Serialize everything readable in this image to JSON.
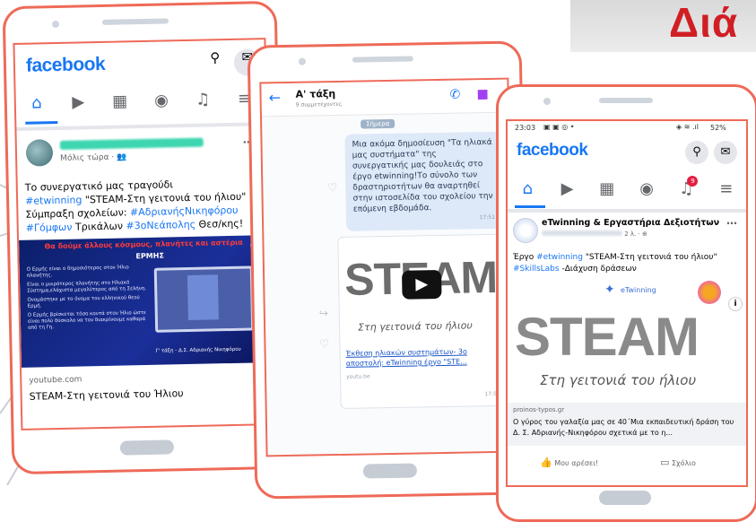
{
  "banner_text": "Διά",
  "phone1": {
    "logo": "facebook",
    "nav_icons": [
      "home-icon",
      "video-icon",
      "marketplace-icon",
      "profile-icon",
      "bell-icon",
      "menu-icon"
    ],
    "post_meta": "Μόλις τώρα · ",
    "post_text_1": "Το συνεργατικό μας τραγούδι",
    "post_line2_tag": "#etwinning",
    "post_line2_rest": " \"STEAM-Στη γειτονιά του ήλιου\"",
    "post_line3_pre": "Σύμπραξη σχολείων: ",
    "post_line3_tag": "#ΑδριανήςΝικηφόρου",
    "post_line4_tag1": "#Γόμφων",
    "post_line4_mid": " Τρικάλων ",
    "post_line4_tag2": "#3οΝεάπολης",
    "post_line4_end": " Θεσ/κης!",
    "video_heading": "Θα δούμε άλλους κόσμους, πλανήτες και αστέρια",
    "video_label": "ΕΡΜΗΣ",
    "video_list": [
      "Ο Ερμής είναι ο δημοσιότερος στον Ήλιο πλανήτης.",
      "Είναι ο μικρότερος πλανήτης στο Ηλιακό Σύστημα,ελάχιστα μεγαλύτερος από τη Σελήνη.",
      "Ονομάστηκε με το όνομα του ελληνικού θεού Ερμή.",
      "Ο Ερμής βρίσκεται τόσο κοντά στον Ήλιο ώστε είναι πολύ δύσκολο να τον διακρίνουμε καθαρά από τη Γη."
    ],
    "video_credit": "Γ' τάξη - Δ.Σ. Αδριανής Νικηφόρου",
    "link_domain": "youtube.com",
    "link_title": "STEAM-Στη γειτονιά του Ήλιου"
  },
  "phone2": {
    "chat_title": "Α' τάξη",
    "chat_subtitle": "9 συμμετέχοντες",
    "date_chip": "Σήμερα",
    "bubble_text": "Μια ακόμα δημοσίευση \"Τα ηλιακά μας συστήματα\" της συνεργατικής μας δουλειάς στο έργο etwinning!Το σύνολο των δραστηριοτήτων θα αναρτηθεί στην ιστοσελίδα του σχολείου την επόμενη εβδομάδα.",
    "bubble_time": "17:51",
    "steam_text": "STEAM",
    "steam_subtitle": "Στη γειτονιά του ήλιου",
    "link_text": "Έκθεση ηλιακών συστημάτων- 3ο αποστολή: eTwinning έργο \"STE...",
    "link_domain": "youtu.be",
    "link_time": "17:52"
  },
  "phone3": {
    "status_time": "23:03",
    "status_battery": "52%",
    "logo": "facebook",
    "page_name": "eTwinning & Εργαστήρια Δεξιοτήτων",
    "post_meta": "2 λ. · ",
    "post_text_pre": "Έργο ",
    "post_tag1": "#etwinning",
    "post_text_mid": " \"STEAM-Στη γειτονιά του ήλιου\" ",
    "post_tag2": "#SkillsLabs",
    "post_text_end": " -Διάχυση δράσεων",
    "etwinning_label": "eTwinning",
    "steam_text": "STEAM",
    "steam_subtitle": "Στη γειτονιά του ήλιου",
    "link_domain": "proinos-typos.gr",
    "link_title": "Ο γύρος του γαλαξία μας σε 40΄Μια εκπαιδευτική δράση του Δ. Σ. Αδριανής-Νικηφόρου σχετικά με το η...",
    "like_label": "Μου αρέσει!",
    "comment_label": "Σχόλιο",
    "notification_count": "9"
  }
}
